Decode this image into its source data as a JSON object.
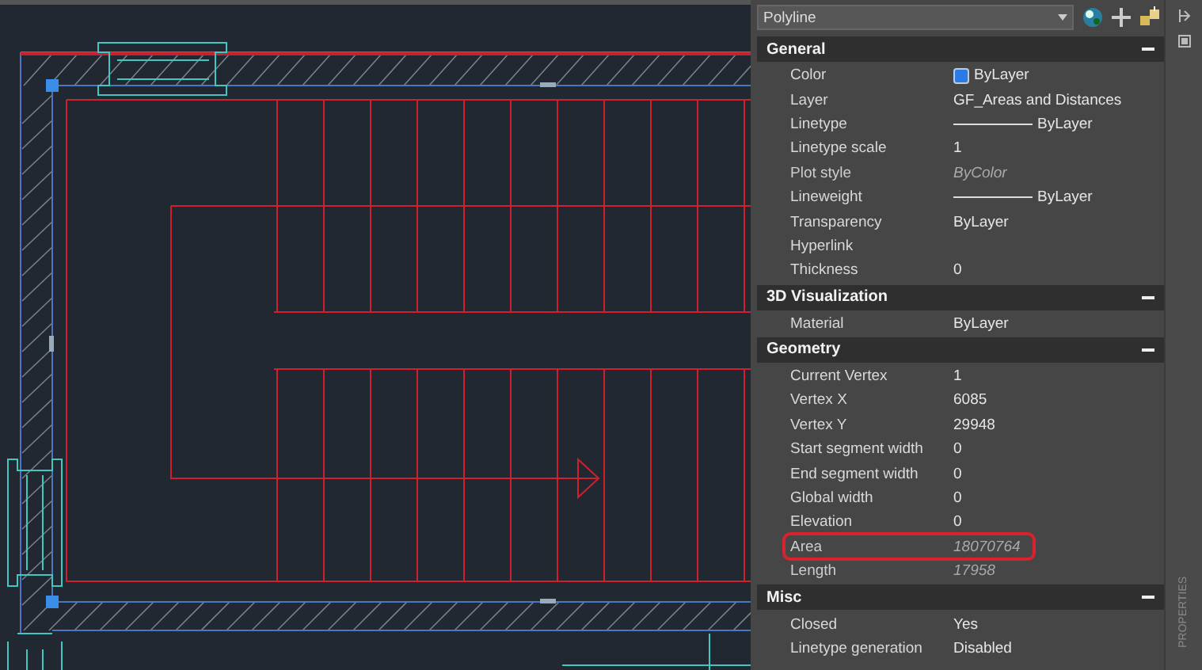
{
  "selector": {
    "value": "Polyline"
  },
  "sections": [
    {
      "title": "General",
      "expanded": true,
      "rows": [
        {
          "label": "Color",
          "value": "ByLayer",
          "kind": "swatch",
          "disabled": false,
          "highlighted": false
        },
        {
          "label": "Layer",
          "value": "GF_Areas and Distances",
          "kind": "plain",
          "disabled": false,
          "highlighted": false
        },
        {
          "label": "Linetype",
          "value": "ByLayer",
          "kind": "line",
          "disabled": false,
          "highlighted": false
        },
        {
          "label": "Linetype scale",
          "value": "1",
          "kind": "plain",
          "disabled": false,
          "highlighted": false
        },
        {
          "label": "Plot style",
          "value": "ByColor",
          "kind": "plain",
          "disabled": true,
          "highlighted": false
        },
        {
          "label": "Lineweight",
          "value": "ByLayer",
          "kind": "line",
          "disabled": false,
          "highlighted": false
        },
        {
          "label": "Transparency",
          "value": "ByLayer",
          "kind": "plain",
          "disabled": false,
          "highlighted": false
        },
        {
          "label": "Hyperlink",
          "kind": "plain",
          "disabled": false,
          "highlighted": false
        },
        {
          "label": "Thickness",
          "value": "0",
          "kind": "plain",
          "disabled": false,
          "highlighted": false
        }
      ]
    },
    {
      "title": "3D Visualization",
      "expanded": true,
      "rows": [
        {
          "label": "Material",
          "value": "ByLayer",
          "kind": "plain",
          "disabled": false,
          "highlighted": false
        }
      ]
    },
    {
      "title": "Geometry",
      "expanded": true,
      "rows": [
        {
          "label": "Current Vertex",
          "value": "1",
          "kind": "plain",
          "disabled": false,
          "highlighted": false
        },
        {
          "label": "Vertex X",
          "value": "6085",
          "kind": "plain",
          "disabled": false,
          "highlighted": false
        },
        {
          "label": "Vertex Y",
          "value": "29948",
          "kind": "plain",
          "disabled": false,
          "highlighted": false
        },
        {
          "label": "Start segment width",
          "value": "0",
          "kind": "plain",
          "disabled": false,
          "highlighted": false
        },
        {
          "label": "End segment width",
          "value": "0",
          "kind": "plain",
          "disabled": false,
          "highlighted": false
        },
        {
          "label": "Global width",
          "value": "0",
          "kind": "plain",
          "disabled": false,
          "highlighted": false
        },
        {
          "label": "Elevation",
          "value": "0",
          "kind": "plain",
          "disabled": false,
          "highlighted": false
        },
        {
          "label": "Area",
          "value": "18070764",
          "kind": "plain",
          "disabled": true,
          "highlighted": true
        },
        {
          "label": "Length",
          "value": "17958",
          "kind": "plain",
          "disabled": true,
          "highlighted": false
        }
      ]
    },
    {
      "title": "Misc",
      "expanded": true,
      "rows": [
        {
          "label": "Closed",
          "value": "Yes",
          "kind": "plain",
          "disabled": false,
          "highlighted": false
        },
        {
          "label": "Linetype generation",
          "value": "Disabled",
          "kind": "plain",
          "disabled": false,
          "highlighted": false
        }
      ]
    }
  ],
  "side_label": "PROPERTIES"
}
